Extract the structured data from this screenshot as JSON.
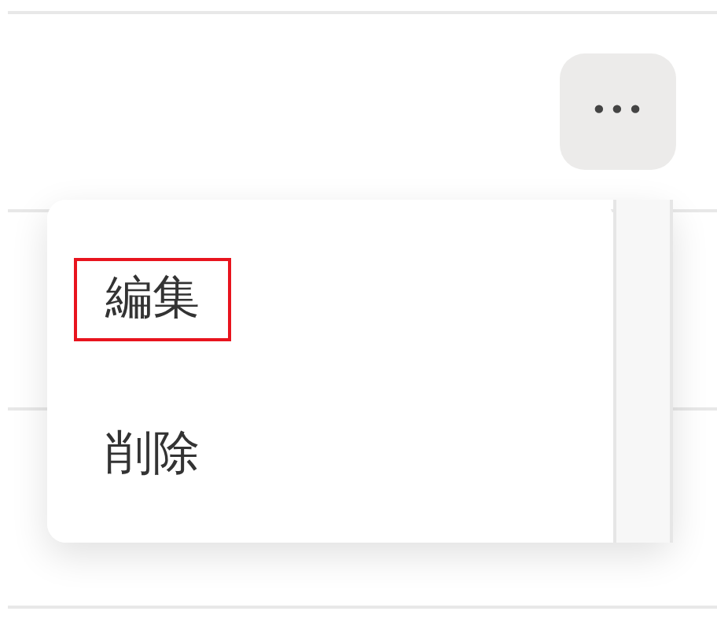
{
  "more_button": {
    "label": "•••"
  },
  "menu": {
    "items": [
      {
        "label": "編集",
        "highlighted": true
      },
      {
        "label": "削除",
        "highlighted": false
      }
    ]
  }
}
